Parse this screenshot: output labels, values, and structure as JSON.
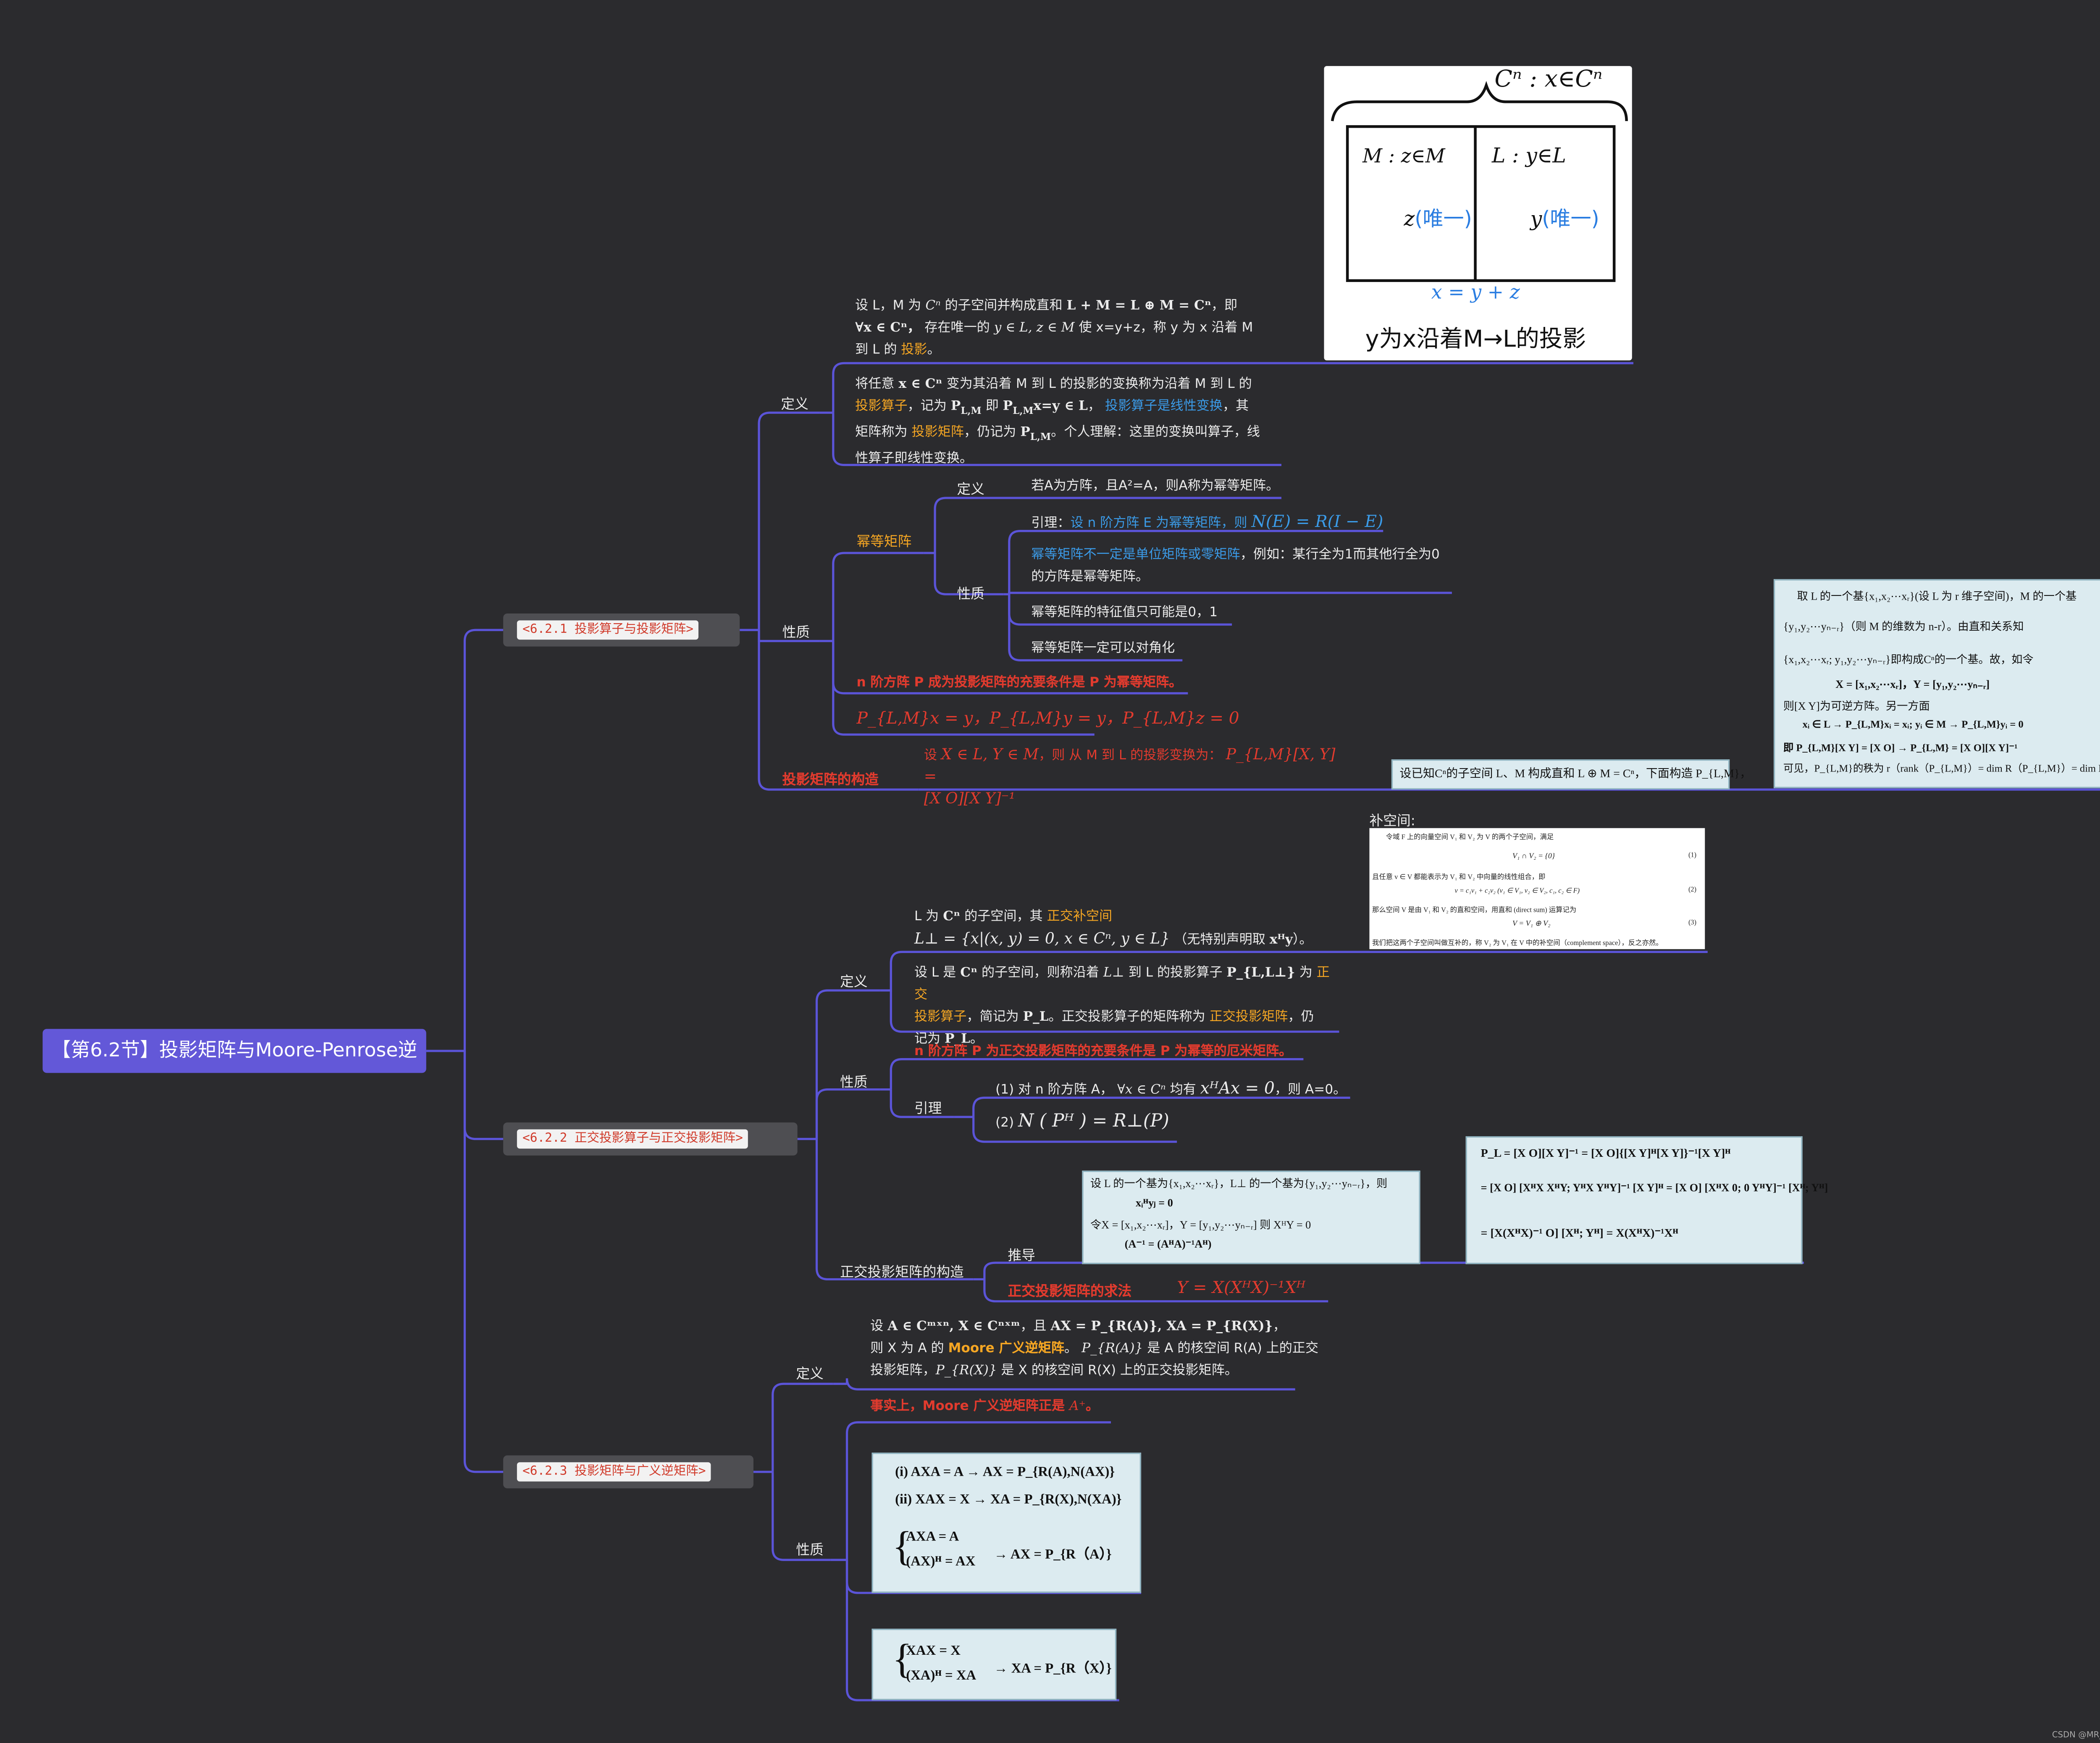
{
  "root": "【第6.2节】投影矩阵与Moore-Penrose逆",
  "sections": {
    "s1": "<6.2.1 投影算子与投影矩阵>",
    "s2": "<6.2.2 正交投影算子与正交投影矩阵>",
    "s3": "<6.2.3 投影矩阵与广义逆矩阵>"
  },
  "s1": {
    "def_label": "定义",
    "def1_a": "设 L，M 为",
    "def1_b": "Cⁿ",
    "def1_c": "的子空间并构成直和",
    "def1_d": "L + M = L ⊕ M = Cⁿ",
    "def1_e": "，即",
    "def1_f": "∀x ∈ Cⁿ，",
    "def1_g": "存在唯一的",
    "def1_h": "y ∈ L, z ∈ M",
    "def1_i": "使 x=y+z，称 y 为 x 沿着 M",
    "def1_j": "到 L 的",
    "def1_k": "投影",
    "def1_l": "。",
    "def2_a": "将任意",
    "def2_b": "x ∈ Cⁿ",
    "def2_c": "变为其沿着 M 到 L 的投影的变换称为沿着 M 到 L 的",
    "def2_d": "投影算子",
    "def2_e": "，记为",
    "def2_f": "P",
    "def2_g": "L,M",
    "def2_h": "即",
    "def2_i": "P",
    "def2_j": "L,M",
    "def2_k": "x=y ∈ L",
    "def2_l": "，",
    "def2_m": "投影算子是线性变换",
    "def2_n": "，其",
    "def2_o": "矩阵称为",
    "def2_p": "投影矩阵",
    "def2_q": "，仍记为",
    "def2_r": "P",
    "def2_s": "L,M",
    "def2_t": "。个人理解：这里的变换叫算子，线",
    "def2_u": "性算子即线性变换。",
    "prop_label": "性质",
    "idem_label": "幂等矩阵",
    "idem_def_label": "定义",
    "idem_def": "若A为方阵，且A²=A，则A称为幂等矩阵。",
    "idem_prop_label": "性质",
    "lemma_a": "引理：",
    "lemma_b": "设 n 阶方阵 E 为幂等矩阵，则",
    "lemma_c": "N(E) = R(I − E)",
    "p2_a": "幂等矩阵不一定是单位矩阵或零矩阵",
    "p2_b": "，例如：某行全为1而其他行全为0",
    "p2_c": "的方阵是幂等矩阵。",
    "p3": "幂等矩阵的特征值只可能是0，1",
    "p4": "幂等矩阵一定可以对角化",
    "nsc": "n 阶方阵 P 成为投影矩阵的充要条件是 P 为幂等矩阵。",
    "eqs": "P_{L,M}x = y，P_{L,M}y = y，P_{L,M}z = 0",
    "constr_label": "投影矩阵的构造",
    "constr_a": "设",
    "constr_b": "X ∈ L, Y ∈ M",
    "constr_c": "，则 从 M 到 L 的投影变换为：",
    "constr_d": "P_{L,M}[X, Y] =",
    "constr_e": "[X   O][X   Y]⁻¹",
    "constr_note": "设已知Cⁿ的子空间 L、M 构成直和 L ⊕ M = Cⁿ，下面构造 P_{L,M}，"
  },
  "sketch": {
    "top": "Cⁿ : x∈Cⁿ",
    "m": "M : z∈M",
    "l": "L : y∈L",
    "z": "z",
    "z_u": "(唯一)",
    "y": "y",
    "y_u": "(唯一)",
    "eq": "x = y + z",
    "caption": "y为x沿着M→L的投影"
  },
  "panel1": {
    "l1": "取 L 的一个基{x₁,x₂⋯xᵣ}(设 L 为 r 维子空间)，M 的一个基",
    "l2": "{y₁,y₂⋯yₙ₋ᵣ}（则 M 的维数为 n-r）。由直和关系知",
    "l3": "{x₁,x₂⋯xᵣ; y₁,y₂⋯yₙ₋ᵣ}即构成Cⁿ的一个基。故，如令",
    "l4": "X = [x₁,x₂⋯xᵣ]，Y = [y₁,y₂⋯yₙ₋ᵣ]",
    "l5": "则[X   Y]为可逆方阵。另一方面",
    "l6": "xᵢ ∈ L → P_{L,M}xᵢ = xᵢ; yᵢ ∈ M → P_{L,M}yᵢ = 0",
    "l7": "即   P_{L,M}[X Y] = [X O] → P_{L,M} = [X O][X Y]⁻¹",
    "l8": "可见，P_{L,M}的秩为 r（rank（P_{L,M}）= dim R（P_{L,M}）= dim L）"
  },
  "s2": {
    "def_label": "定义",
    "def1_a": "L 为",
    "def1_b": "Cⁿ",
    "def1_c": "的子空间，其",
    "def1_d": "正交补空间",
    "def1_e": "L⊥ = {x|(x, y) = 0, x ∈ Cⁿ, y ∈ L}",
    "def1_f": "（无特别声明取",
    "def1_g": "xᴴy",
    "def1_h": "）。",
    "def2_a": "设 L 是",
    "def2_b": "Cⁿ",
    "def2_c": "的子空间，则称沿着",
    "def2_d": "L⊥",
    "def2_e": "到 L 的投影算子",
    "def2_f": "P_{L,L⊥}",
    "def2_g": "为",
    "def2_h": "正交",
    "def2_i": "投影算子",
    "def2_j": "，简记为",
    "def2_k": "P_L",
    "def2_l": "。正交投影算子的矩阵称为",
    "def2_m": "正交投影矩阵",
    "def2_n": "，仍",
    "def2_o": "记为",
    "def2_p": "P_L",
    "def2_q": "。",
    "prop_label": "性质",
    "nsc": "n 阶方阵 P 为正交投影矩阵的充要条件是 P 为幂等的厄米矩阵。",
    "lemma_label": "引理",
    "lemma1_a": "(1)  对 n 阶方阵 A，",
    "lemma1_b": "∀x ∈ Cⁿ",
    "lemma1_c": "均有",
    "lemma1_d": "xᴴAx = 0",
    "lemma1_e": "，则 A=0。",
    "lemma2_a": "(2)",
    "lemma2_b": "N ( Pᴴ ) = R⊥(P)",
    "constr_label": "正交投影矩阵的构造",
    "derive_label": "推导",
    "solve_label": "正交投影矩阵的求法",
    "solve_eq": "Y = X(XᴴX)⁻¹Xᴴ",
    "comp_label": "补空间:"
  },
  "comp_panel": {
    "l1": "令域 F 上的向量空间 V₁ 和 V₂ 为 V 的两个子空间，满足",
    "eq1": "V₁ ∩ V₂ = {0}",
    "n1": "(1)",
    "l2": "且任意 v ∈ V 都能表示为 V₁ 和 V₂ 中向量的线性组合，即",
    "eq2": "v = c₁v₁ + c₂v₂      (v₁ ∈ V₁, v₂ ∈ V₂, c₁, c₂ ∈ F)",
    "n2": "(2)",
    "l3": "那么空间 V 是由 V₁ 和 V₂ 的直和空间，用直和 (direct sum) 运算记为",
    "eq3": "V = V₁ ⊕ V₂",
    "n3": "(3)",
    "l4": "我们把这两个子空间叫做互补的，称 V₂ 为 V₁ 在 V 中的补空间（complement space），反之亦然。"
  },
  "panel2": {
    "l1": "设 L 的一个基为{x₁,x₂⋯xᵣ}，L⊥ 的一个基为{y₁,y₂⋯yₙ₋ᵣ}，则",
    "l2": "xᵢᴴyⱼ = 0",
    "l3": "令X = [x₁,x₂⋯xᵣ]，Y = [y₁,y₂⋯yₙ₋ᵣ] 则 XᴴY = 0",
    "l4": "(A⁻¹ = (AᴴA)⁻¹Aᴴ)"
  },
  "panel3": {
    "l1": "P_L = [X O][X Y]⁻¹ = [X O]{[X Y]ᴴ[X Y]}⁻¹[X Y]ᴴ",
    "l2": "= [X O] [XᴴX  XᴴY; YᴴX  YᴴY]⁻¹ [X Y]ᴴ = [X O] [XᴴX  0; 0  YᴴY]⁻¹ [Xᴴ; Yᴴ]",
    "l3": "= [X(XᴴX)⁻¹   O] [Xᴴ; Yᴴ] = X(XᴴX)⁻¹Xᴴ"
  },
  "s3": {
    "def_label": "定义",
    "def1_a": "设",
    "def1_b": "A ∈ Cᵐˣⁿ, X ∈ Cⁿˣᵐ",
    "def1_c": "，且",
    "def1_d": "AX = P_{R(A)}, XA = P_{R(X)}",
    "def1_e": "，",
    "def2_a": "则 X 为 A 的",
    "def2_b": "Moore 广义逆矩阵",
    "def2_c": "。",
    "def2_d": "P_{R(A)}",
    "def2_e": "是 A 的核空间 R(A) 上的正交",
    "def3_a": "投影矩阵，",
    "def3_b": "P_{R(X)}",
    "def3_c": "是 X 的核空间 R(X) 上的正交投影矩阵。",
    "fact_a": "事实上，Moore 广义逆矩阵正是",
    "fact_b": "A⁺",
    "fact_c": "。",
    "prop_label": "性质"
  },
  "panel4": {
    "l1": "(i) AXA = A → AX = P_{R(A),N(AX)}",
    "l2": "(ii) XAX = X → XA = P_{R(X),N(XA)}",
    "l3a": "AXA = A",
    "l3b": "(AX)ᴴ = AX",
    "l3c": "→ AX = P_{R（A）}"
  },
  "panel5": {
    "l1a": "XAX = X",
    "l1b": "(XA)ᴴ = XA",
    "l1c": "→ XA = P_{R（X）}"
  },
  "footer": "CSDN @MR_Promethus"
}
